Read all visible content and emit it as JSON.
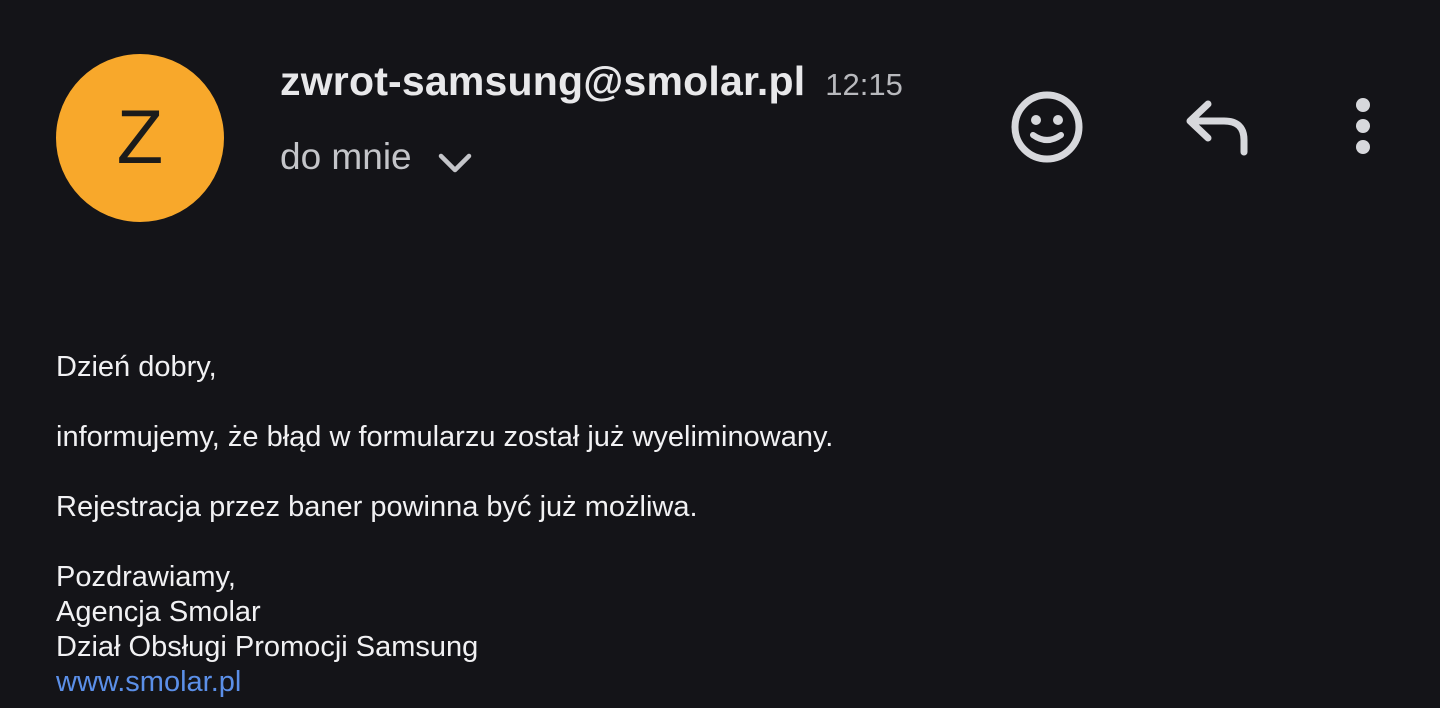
{
  "colors": {
    "background": "#141418",
    "avatar": "#f8a82b",
    "link": "#5b8fe8",
    "icon": "#d7d8dc"
  },
  "header": {
    "avatar_letter": "Z",
    "sender_email": "zwrot-samsung@smolar.pl",
    "time": "12:15",
    "recipient_label": "do mnie",
    "icons": {
      "expand": "chevron-down-icon",
      "emoji": "emoji-reaction-icon",
      "reply": "reply-icon",
      "more": "more-vert-icon"
    }
  },
  "message": {
    "greeting": "Dzień dobry,",
    "line1": "informujemy, że błąd w formularzu został już wyeliminowany.",
    "line2": "Rejestracja przez baner powinna być już możliwa.",
    "signature": {
      "closing": "Pozdrawiamy,",
      "company": "Agencja Smolar",
      "department": "Dział Obsługi Promocji Samsung",
      "link_text": "www.smolar.pl"
    }
  }
}
